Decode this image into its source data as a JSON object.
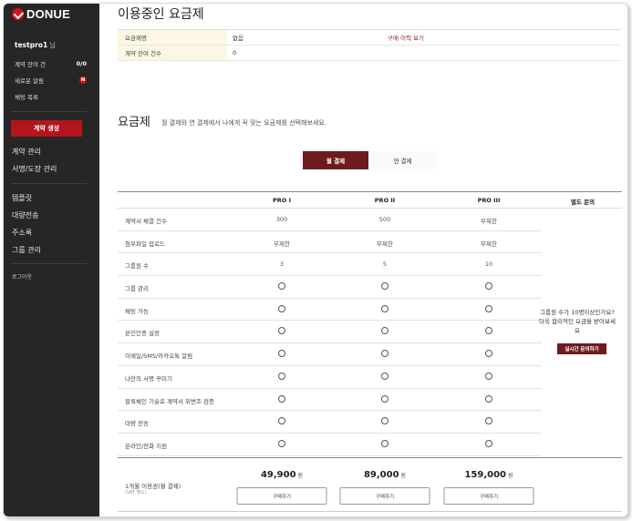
{
  "sidebar": {
    "logo_text": "DONUE",
    "username": "testpro1",
    "username_suffix": "님",
    "contract_remaining_label": "계약 잔여 건",
    "contract_remaining_value": "0/0",
    "new_alerts_label": "새로운 알림",
    "new_alerts_badge": "N",
    "chat_list_label": "채팅 목록",
    "create_contract_button": "계약 생성",
    "menu": [
      "계약 관리",
      "서명/도장 관리",
      "템플릿",
      "대량전송",
      "주소록",
      "그룹 관리"
    ],
    "logout": "로그아웃"
  },
  "current_plan": {
    "title": "이용중인 요금제",
    "rows": [
      {
        "label": "요금제명",
        "value": "없음",
        "link": "구매 이력 보기"
      },
      {
        "label": "계약 잔여 건수",
        "value": "0",
        "link": ""
      }
    ]
  },
  "plans_section": {
    "title": "요금제",
    "subtitle": "월 결제와 연 결제에서 나에게 꼭 맞는 요금제를 선택해보세요.",
    "toggle_monthly": "월 결제",
    "toggle_yearly": "연 결제",
    "columns": [
      "PRO I",
      "PRO II",
      "PRO III",
      "별도 문의"
    ],
    "features": [
      {
        "name": "계약서 체결 건수",
        "values": [
          "300",
          "500",
          "무제한"
        ]
      },
      {
        "name": "첨부파일 업로드",
        "values": [
          "무제한",
          "무제한",
          "무제한"
        ]
      },
      {
        "name": "그룹원 수",
        "values": [
          "3",
          "5",
          "10"
        ]
      },
      {
        "name": "그룹 관리",
        "values": [
          "○",
          "○",
          "○"
        ]
      },
      {
        "name": "채팅 가능",
        "values": [
          "○",
          "○",
          "○"
        ]
      },
      {
        "name": "본인인증 설정",
        "values": [
          "○",
          "○",
          "○"
        ]
      },
      {
        "name": "이메일/SMS/카카오톡 알림",
        "values": [
          "○",
          "○",
          "○"
        ]
      },
      {
        "name": "나만의 서명 꾸미기",
        "values": [
          "○",
          "○",
          "○"
        ]
      },
      {
        "name": "블록체인 기술로 계약서 위변조 검증",
        "values": [
          "○",
          "○",
          "○"
        ]
      },
      {
        "name": "대량 전송",
        "values": [
          "○",
          "○",
          "○"
        ]
      },
      {
        "name": "온라인/전화 지원",
        "values": [
          "○",
          "○",
          "○"
        ]
      }
    ],
    "inquiry_text": "그룹원 수가 10명이상인가요? 더욱 합리적인 요금을 받아보세요",
    "inquiry_button": "실시간 문의하기",
    "price_label": "1개월 이용권(월 결제)",
    "price_note": "(VAT 별도)",
    "prices": [
      "49,900",
      "89,000",
      "159,000"
    ],
    "currency": "원",
    "buy_button": "구매하기"
  }
}
